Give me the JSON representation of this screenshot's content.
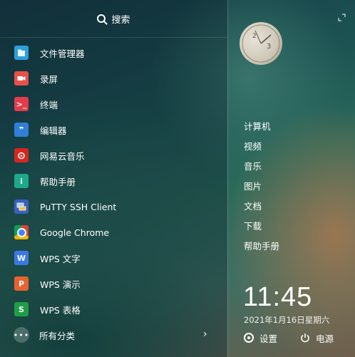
{
  "search": {
    "label": "搜索"
  },
  "apps": [
    {
      "name": "文件管理器",
      "icon": "file-manager-icon"
    },
    {
      "name": "录屏",
      "icon": "screen-recorder-icon"
    },
    {
      "name": "终端",
      "icon": "terminal-icon"
    },
    {
      "name": "编辑器",
      "icon": "text-editor-icon"
    },
    {
      "name": "网易云音乐",
      "icon": "netease-music-icon"
    },
    {
      "name": "帮助手册",
      "icon": "help-manual-icon"
    },
    {
      "name": "PuTTY SSH Client",
      "icon": "putty-icon"
    },
    {
      "name": "Google Chrome",
      "icon": "chrome-icon"
    },
    {
      "name": "WPS 文字",
      "icon": "wps-writer-icon"
    },
    {
      "name": "WPS 演示",
      "icon": "wps-presentation-icon"
    },
    {
      "name": "WPS 表格",
      "icon": "wps-spreadsheet-icon"
    }
  ],
  "all_categories": {
    "label": "所有分类"
  },
  "places": [
    "计算机",
    "视频",
    "音乐",
    "图片",
    "文档",
    "下载",
    "帮助手册"
  ],
  "clock": {
    "time": "11:45",
    "date": "2021年1月16日星期六"
  },
  "footer": {
    "settings_label": "设置",
    "power_label": "电源"
  }
}
